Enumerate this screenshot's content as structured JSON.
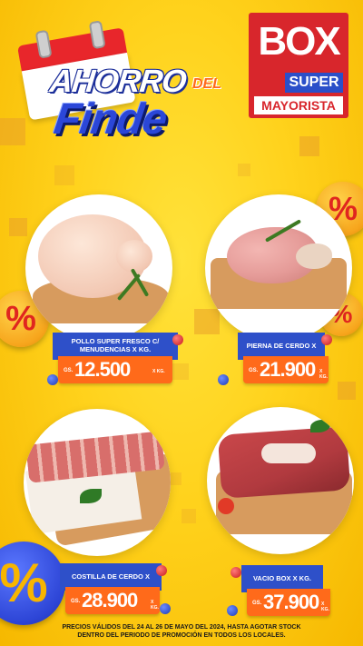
{
  "header": {
    "title_line1": "AHORRO",
    "title_del": "DEL",
    "title_line2": "Finde"
  },
  "logo": {
    "line1": "BOX",
    "line2": "SUPER",
    "line3": "MAYORISTA"
  },
  "colors": {
    "background": "#ffd21c",
    "brand_red": "#d8262c",
    "brand_blue": "#2e50c9",
    "price_orange": "#ff6a1a"
  },
  "products": [
    {
      "name": "POLLO SUPER FRESCO C/ MENUDENCIAS X KG.",
      "currency": "GS.",
      "price": "12.500",
      "unit": "X KG."
    },
    {
      "name": "PIERNA DE CERDO X KG.",
      "currency": "GS.",
      "price": "21.900",
      "unit": "X KG."
    },
    {
      "name": "COSTILLA DE CERDO X KG.",
      "currency": "GS.",
      "price": "28.900",
      "unit": "X KG."
    },
    {
      "name": "VACIO BOX X KG.",
      "currency": "GS.",
      "price": "37.900",
      "unit": "X KG."
    }
  ],
  "decor": {
    "percent_symbol": "%"
  },
  "footer": {
    "line1": "PRECIOS VÁLIDOS DEL 24 AL 26 DE MAYO DEL 2024, HASTA AGOTAR STOCK",
    "line2": "DENTRO DEL PERIODO DE PROMOCIÓN EN TODOS LOS LOCALES."
  }
}
